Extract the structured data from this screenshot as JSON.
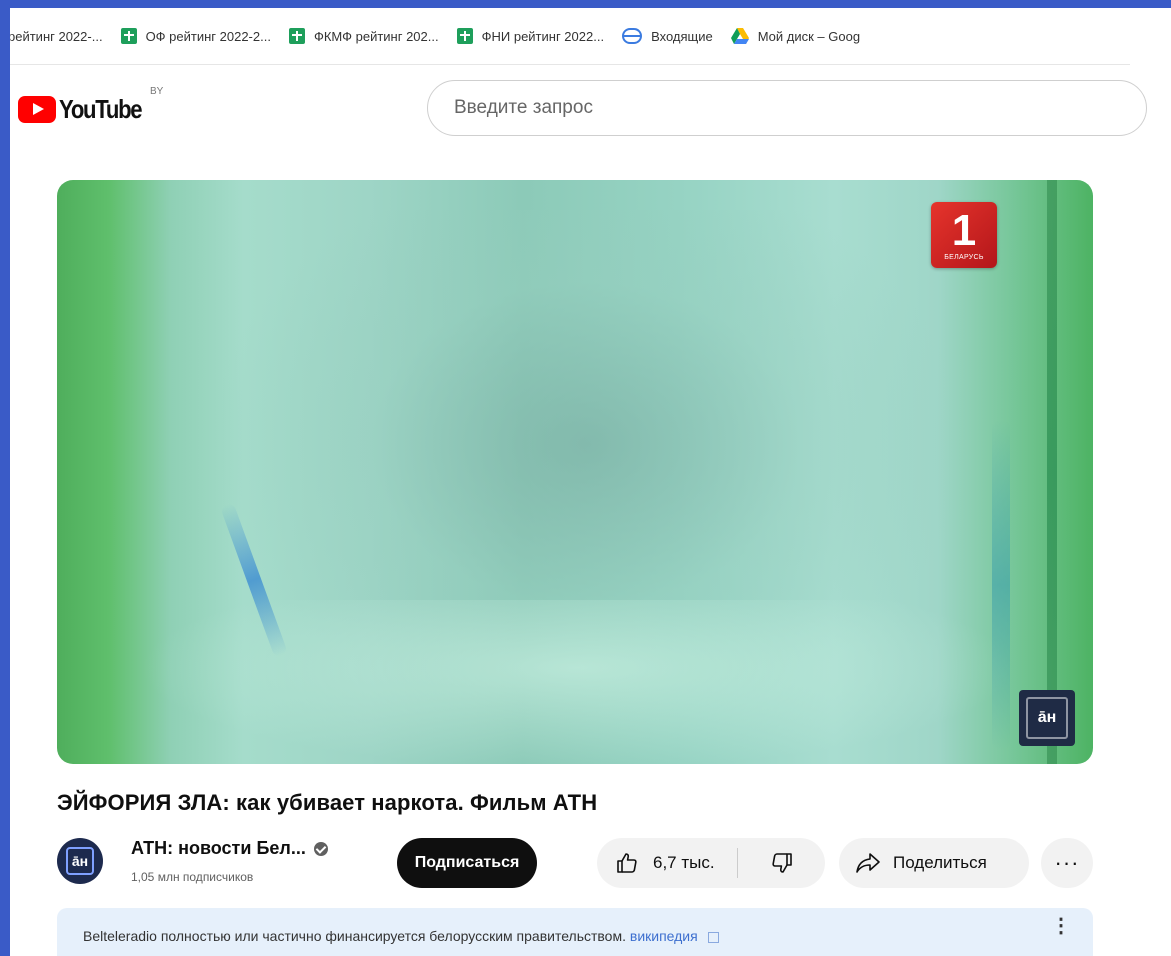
{
  "bookmarks": [
    {
      "label": "рейтинг 2022-...",
      "icon": "sheets-icon"
    },
    {
      "label": "ОФ рейтинг 2022-2...",
      "icon": "sheets-icon"
    },
    {
      "label": "ФКМФ рейтинг 202...",
      "icon": "sheets-icon"
    },
    {
      "label": "ФНИ рейтинг 2022...",
      "icon": "sheets-icon"
    },
    {
      "label": "Входящие",
      "icon": "mail-icon"
    },
    {
      "label": "Мой диск – Goog",
      "icon": "drive-icon"
    }
  ],
  "header": {
    "logo_text": "YouTube",
    "country_code": "BY",
    "search_placeholder": "Введите запрос"
  },
  "player": {
    "channel_logo_number": "1",
    "channel_logo_sub": "БЕЛАРУСЬ",
    "badge_text": "āн"
  },
  "video": {
    "title": "ЭЙФОРИЯ ЗЛА: как убивает наркота. Фильм АТН"
  },
  "channel": {
    "avatar_text": "āн",
    "name": "АТН: новости Бел...",
    "subscribers": "1,05 млн подписчиков",
    "subscribe_label": "Подписаться"
  },
  "actions": {
    "likes": "6,7 тыс.",
    "share_label": "Поделиться",
    "more_label": "···"
  },
  "notice": {
    "text": "Belteleradio полностью или частично финансируется белорусским правительством.",
    "link": "википедия",
    "menu": "⋮"
  },
  "colors": {
    "youtube_red": "#ff0000",
    "subscribe_bg": "#0f0f0f",
    "notice_bg": "#e6f0fb",
    "link": "#3d6fcf"
  }
}
